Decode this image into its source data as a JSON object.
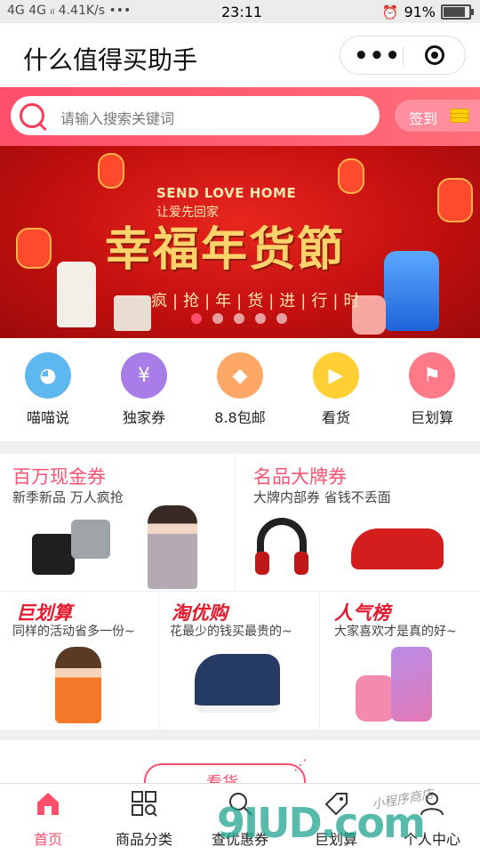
{
  "status_bar": {
    "network": "4G 4G ᵢₗ 4.41K/s •••",
    "time": "23:11",
    "alarm_icon": "alarm-icon",
    "battery": "91%",
    "battery_fraction": 0.91
  },
  "title_bar": {
    "title": "什么值得买助手",
    "more_icon": "more-dots-icon",
    "close_icon": "target-icon"
  },
  "search": {
    "placeholder": "请输入搜索关键词",
    "signin_label": "签到",
    "accent": "#ff4f6b"
  },
  "banner": {
    "en_title": "SEND LOVE HOME",
    "sub_title": "让爱先回家",
    "main_title": "幸福年货節",
    "slogan": "疯|抢|年|货|进|行|时",
    "dots": 5,
    "active_dot": 1
  },
  "nav_items": [
    {
      "label": "喵喵说",
      "icon": "cat-icon",
      "color": "#5eb8f0"
    },
    {
      "label": "独家券",
      "icon": "ticket-icon",
      "color": "#a97de8"
    },
    {
      "label": "8.8包邮",
      "icon": "diamond-icon",
      "color": "#ffa766"
    },
    {
      "label": "看货",
      "icon": "video-icon",
      "color": "#ffcf33"
    },
    {
      "label": "巨划算",
      "icon": "flag-icon",
      "color": "#ff7a88"
    }
  ],
  "coupons_top": [
    {
      "title": "百万现金券",
      "subtitle": "新季新品 万人疯抢"
    },
    {
      "title": "名品大牌券",
      "subtitle": "大牌内部券 省钱不丢面"
    }
  ],
  "coupons_bottom": [
    {
      "title": "巨划算",
      "subtitle": "同样的活动省多一份~"
    },
    {
      "title": "淘优购",
      "subtitle": "花最少的钱买最贵的~"
    },
    {
      "title": "人气榜",
      "subtitle": "大家喜欢才是真的好~"
    }
  ],
  "section": {
    "kanhuo_label": "看货"
  },
  "tabs": [
    {
      "label": "首页",
      "icon": "home-icon",
      "active": true
    },
    {
      "label": "商品分类",
      "icon": "grid-search-icon",
      "active": false
    },
    {
      "label": "查优惠券",
      "icon": "coupon-search-icon",
      "active": false
    },
    {
      "label": "巨划算",
      "icon": "tag-icon",
      "active": false
    },
    {
      "label": "个人中心",
      "icon": "user-icon",
      "active": false
    }
  ],
  "watermark": {
    "text": "9IUD.com",
    "script": "小程序商店"
  }
}
